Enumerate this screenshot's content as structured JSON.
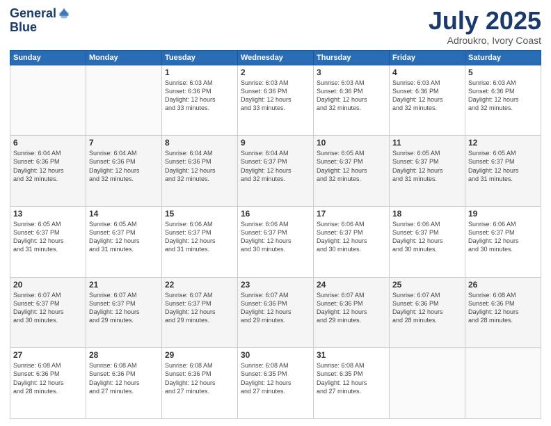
{
  "header": {
    "logo_line1": "General",
    "logo_line2": "Blue",
    "title": "July 2025",
    "subtitle": "Adroukro, Ivory Coast"
  },
  "days_of_week": [
    "Sunday",
    "Monday",
    "Tuesday",
    "Wednesday",
    "Thursday",
    "Friday",
    "Saturday"
  ],
  "weeks": [
    [
      {
        "day": "",
        "info": ""
      },
      {
        "day": "",
        "info": ""
      },
      {
        "day": "1",
        "info": "Sunrise: 6:03 AM\nSunset: 6:36 PM\nDaylight: 12 hours\nand 33 minutes."
      },
      {
        "day": "2",
        "info": "Sunrise: 6:03 AM\nSunset: 6:36 PM\nDaylight: 12 hours\nand 33 minutes."
      },
      {
        "day": "3",
        "info": "Sunrise: 6:03 AM\nSunset: 6:36 PM\nDaylight: 12 hours\nand 32 minutes."
      },
      {
        "day": "4",
        "info": "Sunrise: 6:03 AM\nSunset: 6:36 PM\nDaylight: 12 hours\nand 32 minutes."
      },
      {
        "day": "5",
        "info": "Sunrise: 6:03 AM\nSunset: 6:36 PM\nDaylight: 12 hours\nand 32 minutes."
      }
    ],
    [
      {
        "day": "6",
        "info": "Sunrise: 6:04 AM\nSunset: 6:36 PM\nDaylight: 12 hours\nand 32 minutes."
      },
      {
        "day": "7",
        "info": "Sunrise: 6:04 AM\nSunset: 6:36 PM\nDaylight: 12 hours\nand 32 minutes."
      },
      {
        "day": "8",
        "info": "Sunrise: 6:04 AM\nSunset: 6:36 PM\nDaylight: 12 hours\nand 32 minutes."
      },
      {
        "day": "9",
        "info": "Sunrise: 6:04 AM\nSunset: 6:37 PM\nDaylight: 12 hours\nand 32 minutes."
      },
      {
        "day": "10",
        "info": "Sunrise: 6:05 AM\nSunset: 6:37 PM\nDaylight: 12 hours\nand 32 minutes."
      },
      {
        "day": "11",
        "info": "Sunrise: 6:05 AM\nSunset: 6:37 PM\nDaylight: 12 hours\nand 31 minutes."
      },
      {
        "day": "12",
        "info": "Sunrise: 6:05 AM\nSunset: 6:37 PM\nDaylight: 12 hours\nand 31 minutes."
      }
    ],
    [
      {
        "day": "13",
        "info": "Sunrise: 6:05 AM\nSunset: 6:37 PM\nDaylight: 12 hours\nand 31 minutes."
      },
      {
        "day": "14",
        "info": "Sunrise: 6:05 AM\nSunset: 6:37 PM\nDaylight: 12 hours\nand 31 minutes."
      },
      {
        "day": "15",
        "info": "Sunrise: 6:06 AM\nSunset: 6:37 PM\nDaylight: 12 hours\nand 31 minutes."
      },
      {
        "day": "16",
        "info": "Sunrise: 6:06 AM\nSunset: 6:37 PM\nDaylight: 12 hours\nand 30 minutes."
      },
      {
        "day": "17",
        "info": "Sunrise: 6:06 AM\nSunset: 6:37 PM\nDaylight: 12 hours\nand 30 minutes."
      },
      {
        "day": "18",
        "info": "Sunrise: 6:06 AM\nSunset: 6:37 PM\nDaylight: 12 hours\nand 30 minutes."
      },
      {
        "day": "19",
        "info": "Sunrise: 6:06 AM\nSunset: 6:37 PM\nDaylight: 12 hours\nand 30 minutes."
      }
    ],
    [
      {
        "day": "20",
        "info": "Sunrise: 6:07 AM\nSunset: 6:37 PM\nDaylight: 12 hours\nand 30 minutes."
      },
      {
        "day": "21",
        "info": "Sunrise: 6:07 AM\nSunset: 6:37 PM\nDaylight: 12 hours\nand 29 minutes."
      },
      {
        "day": "22",
        "info": "Sunrise: 6:07 AM\nSunset: 6:37 PM\nDaylight: 12 hours\nand 29 minutes."
      },
      {
        "day": "23",
        "info": "Sunrise: 6:07 AM\nSunset: 6:36 PM\nDaylight: 12 hours\nand 29 minutes."
      },
      {
        "day": "24",
        "info": "Sunrise: 6:07 AM\nSunset: 6:36 PM\nDaylight: 12 hours\nand 29 minutes."
      },
      {
        "day": "25",
        "info": "Sunrise: 6:07 AM\nSunset: 6:36 PM\nDaylight: 12 hours\nand 28 minutes."
      },
      {
        "day": "26",
        "info": "Sunrise: 6:08 AM\nSunset: 6:36 PM\nDaylight: 12 hours\nand 28 minutes."
      }
    ],
    [
      {
        "day": "27",
        "info": "Sunrise: 6:08 AM\nSunset: 6:36 PM\nDaylight: 12 hours\nand 28 minutes."
      },
      {
        "day": "28",
        "info": "Sunrise: 6:08 AM\nSunset: 6:36 PM\nDaylight: 12 hours\nand 27 minutes."
      },
      {
        "day": "29",
        "info": "Sunrise: 6:08 AM\nSunset: 6:36 PM\nDaylight: 12 hours\nand 27 minutes."
      },
      {
        "day": "30",
        "info": "Sunrise: 6:08 AM\nSunset: 6:35 PM\nDaylight: 12 hours\nand 27 minutes."
      },
      {
        "day": "31",
        "info": "Sunrise: 6:08 AM\nSunset: 6:35 PM\nDaylight: 12 hours\nand 27 minutes."
      },
      {
        "day": "",
        "info": ""
      },
      {
        "day": "",
        "info": ""
      }
    ]
  ]
}
